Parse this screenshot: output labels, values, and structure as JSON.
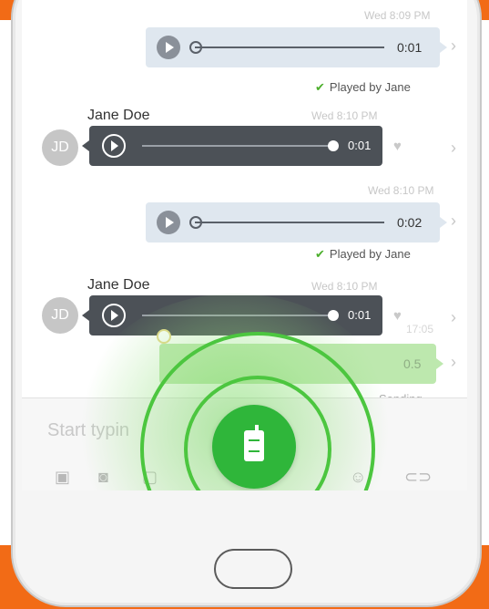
{
  "messages": [
    {
      "type": "outgoing",
      "time": "Wed 8:09 PM",
      "duration": "0:01",
      "status": "Played by Jane"
    },
    {
      "type": "incoming",
      "sender": "Jane Doe",
      "avatar": "JD",
      "time": "Wed 8:10 PM",
      "duration": "0:01"
    },
    {
      "type": "outgoing",
      "time": "Wed 8:10 PM",
      "duration": "0:02",
      "status": "Played by Jane"
    },
    {
      "type": "incoming",
      "sender": "Jane Doe",
      "avatar": "JD",
      "time": "Wed 8:10 PM",
      "duration": "0:01"
    },
    {
      "type": "sending",
      "time": "17:05",
      "duration": "0.5",
      "status": "Sending"
    }
  ],
  "composer": {
    "placeholder": "Start typin"
  },
  "colors": {
    "brand_orange": "#f26b16",
    "record_green": "#2fb63a",
    "bubble_in": "#4c5157",
    "bubble_out": "#dfe7ef"
  },
  "icons": [
    "play-icon",
    "chevron-right-icon",
    "heart-icon",
    "check-icon",
    "image-icon",
    "camera-icon",
    "attachment-icon",
    "walkie-talkie-icon"
  ]
}
